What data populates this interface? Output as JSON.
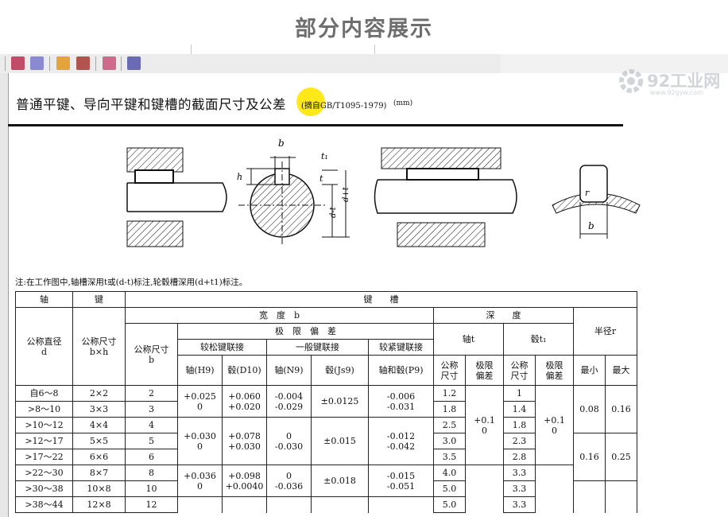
{
  "banner": {
    "title": "部分内容展示"
  },
  "watermark": {
    "text": "92工业网",
    "url": "www.92gyw.com"
  },
  "document": {
    "heading": "普通平键、导向平键和键槽的截面尺寸及公差",
    "reference": "(摘自GB/T1095-1979)",
    "unit": "(mm)",
    "figure_labels": {
      "b": "b",
      "h": "h",
      "t": "t",
      "t1": "t₁",
      "d_minus_t": "d-t",
      "d_plus_t": "d+t",
      "r": "r",
      "b2": "b"
    },
    "note": "注:在工作图中,轴槽深用t或(d-t)标注,轮毂槽深用(d+t1)标注。"
  },
  "table": {
    "headers": {
      "shaft": "轴",
      "key": "键",
      "keyway": "键　　槽",
      "width": "宽　度　b",
      "depth": "深　　度",
      "tolerance": "极　限　偏　差",
      "loose": "较松键联接",
      "normal": "一般键联接",
      "tight": "较紧键联接",
      "shaft_depth": "轴t",
      "hub_depth": "毂t₁",
      "radius": "半径r",
      "nominal_diameter": "公称直径",
      "d": "d",
      "nominal_size": "公称尺寸",
      "bxh": "b×h",
      "nominal_b": "公称尺寸",
      "b": "b",
      "shaft_h9": "轴(H9)",
      "hub_d10": "毂(D10)",
      "shaft_n9": "轴(N9)",
      "hub_js9": "毂(Js9)",
      "shaft_hub_p9": "轴和毂(P9)",
      "nom": "公称",
      "size": "尺寸",
      "limit": "极限",
      "dev": "偏差",
      "min": "最小",
      "max": "最大"
    },
    "rows": [
      {
        "d": "自6～8",
        "bxh": "2×2",
        "b": "2",
        "t": "1.2",
        "t1": "1"
      },
      {
        "d": ">8～10",
        "bxh": "3×3",
        "b": "3",
        "t": "1.8",
        "t1": "1.4"
      },
      {
        "d": ">10～12",
        "bxh": "4×4",
        "b": "4",
        "t": "2.5",
        "t1": "1.8"
      },
      {
        "d": ">12～17",
        "bxh": "5×5",
        "b": "5",
        "t": "3.0",
        "t1": "2.3"
      },
      {
        "d": ">17～22",
        "bxh": "6×6",
        "b": "6",
        "t": "3.5",
        "t1": "2.8"
      },
      {
        "d": ">22～30",
        "bxh": "8×7",
        "b": "8",
        "t": "4.0",
        "t1": "3.3"
      },
      {
        "d": ">30～38",
        "bxh": "10×8",
        "b": "10",
        "t": "5.0",
        "t1": "3.3"
      },
      {
        "d": ">38～44",
        "bxh": "12×8",
        "b": "12",
        "t": "5.0",
        "t1": "3.3"
      }
    ],
    "groups": [
      {
        "h9": [
          "+0.025",
          "0"
        ],
        "d10": [
          "+0.060",
          "+0.020"
        ],
        "n9": [
          "-0.004",
          "-0.029"
        ],
        "js9": "±0.0125",
        "p9": [
          "-0.006",
          "-0.031"
        ]
      },
      {
        "h9": [
          "+0.030",
          "0"
        ],
        "d10": [
          "+0.078",
          "+0.030"
        ],
        "n9": [
          "0",
          "-0.030"
        ],
        "js9": "±0.015",
        "p9": [
          "-0.012",
          "-0.042"
        ]
      },
      {
        "h9": [
          "+0.036",
          "0"
        ],
        "d10": [
          "+0.098",
          "+0.0040"
        ],
        "n9": [
          "0",
          "-0.036"
        ],
        "js9": "±0.018",
        "p9": [
          "-0.015",
          "-0.051"
        ]
      }
    ],
    "shaft_dev": [
      "+0.1",
      "0"
    ],
    "hub_dev": [
      "+0.1",
      "0"
    ],
    "r1": {
      "min": "0.08",
      "max": "0.16"
    },
    "r2": {
      "min": "0.16",
      "max": "0.25"
    }
  }
}
